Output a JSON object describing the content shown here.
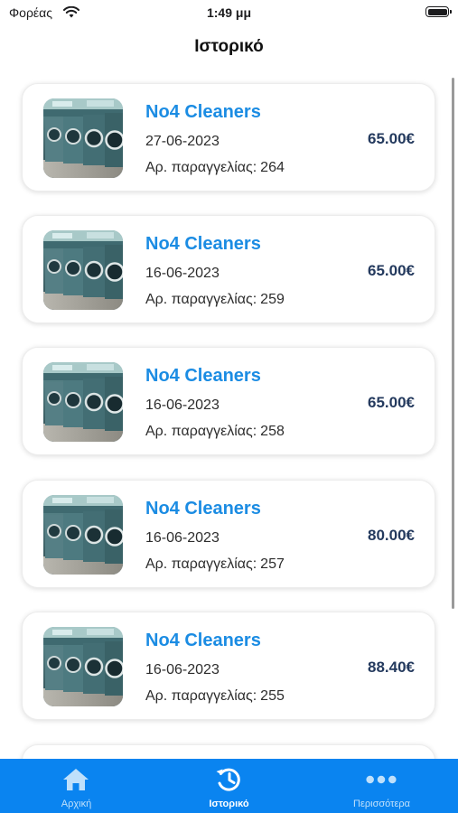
{
  "status_bar": {
    "carrier": "Φορέας",
    "time": "1:49 μμ"
  },
  "header": {
    "title": "Ιστορικό"
  },
  "order_label": "Αρ. παραγγελίας:",
  "orders": [
    {
      "store": "No4 Cleaners",
      "date": "27-06-2023",
      "order_no": "264",
      "price": "65.00€"
    },
    {
      "store": "No4 Cleaners",
      "date": "16-06-2023",
      "order_no": "259",
      "price": "65.00€"
    },
    {
      "store": "No4 Cleaners",
      "date": "16-06-2023",
      "order_no": "258",
      "price": "65.00€"
    },
    {
      "store": "No4 Cleaners",
      "date": "16-06-2023",
      "order_no": "257",
      "price": "80.00€"
    },
    {
      "store": "No4 Cleaners",
      "date": "16-06-2023",
      "order_no": "255",
      "price": "88.40€"
    }
  ],
  "tabs": [
    {
      "label": "Αρχική",
      "icon": "home-icon"
    },
    {
      "label": "Ιστορικό",
      "icon": "history-icon",
      "active": true
    },
    {
      "label": "Περισσότερα",
      "icon": "more-icon"
    }
  ],
  "colors": {
    "accent": "#0a84f0",
    "title_blue": "#1b8ce3",
    "price": "#243a5e"
  }
}
